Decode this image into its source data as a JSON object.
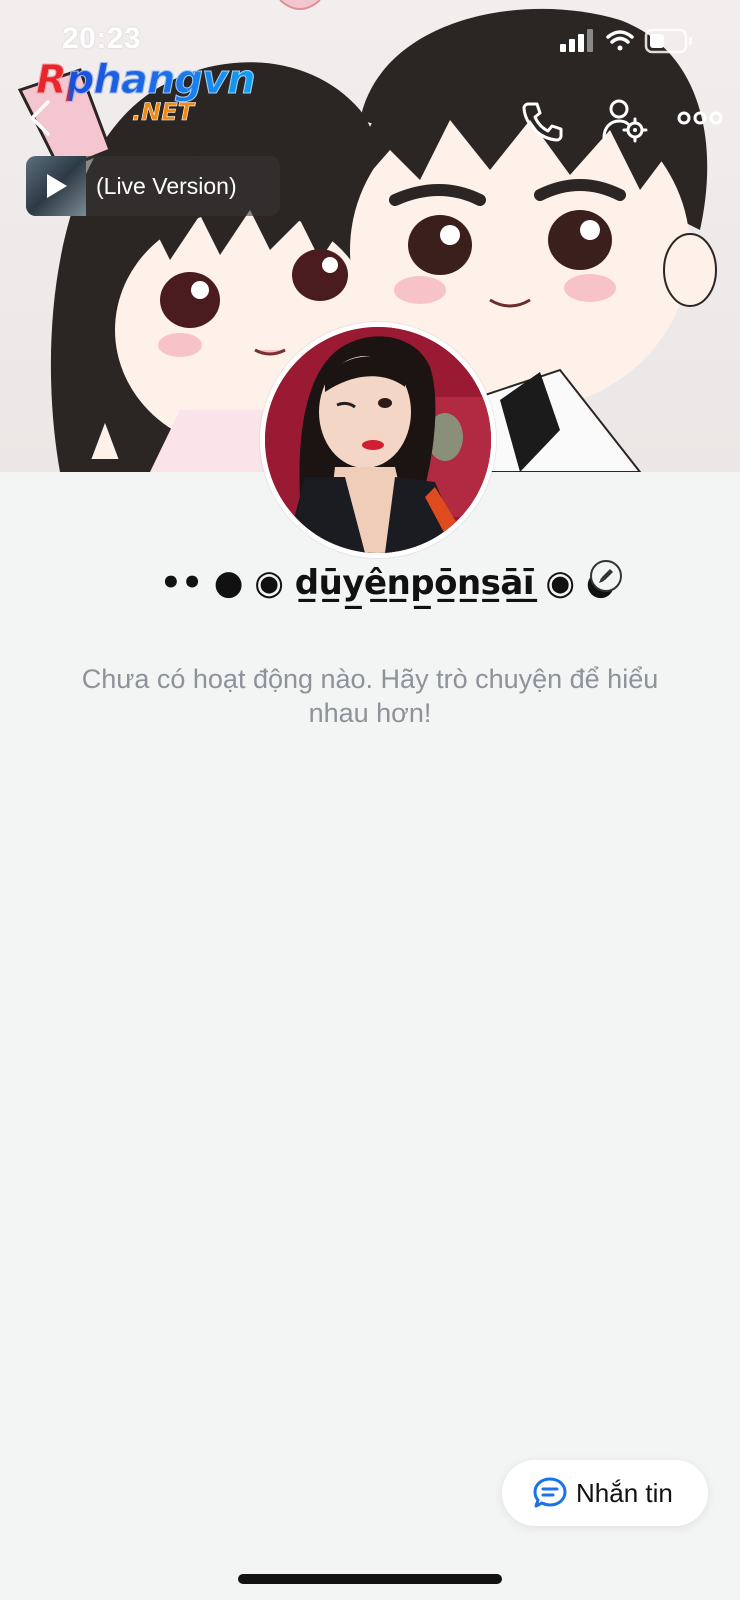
{
  "status_bar": {
    "time": "20:23",
    "icons": [
      "cellular-signal-icon",
      "wifi-icon",
      "battery-icon"
    ]
  },
  "watermark": {
    "main": "Rphangvn",
    "sub": ".NET"
  },
  "header": {
    "icons": [
      "back-icon",
      "phone-icon",
      "friend-settings-icon",
      "more-icon"
    ]
  },
  "music": {
    "title": "(Live Version)"
  },
  "profile": {
    "display_name": "•• ● ◉ d̲ū̲y̲ê̲n̲p̲ō̲n̲s̲ā̲ī̲ ◉ ●"
  },
  "empty_state": {
    "message": "Chưa có hoạt động nào. Hãy trò chuyện để hiểu nhau hơn!"
  },
  "actions": {
    "message_label": "Nhắn tin"
  },
  "colors": {
    "background": "#f3f4f4",
    "accent": "#1a73e8",
    "muted_text": "#8e9299"
  }
}
